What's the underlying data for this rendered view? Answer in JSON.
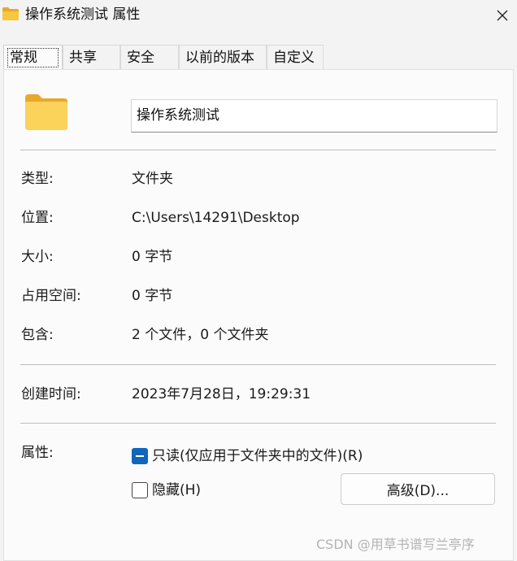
{
  "window": {
    "title": "操作系统测试 属性",
    "icon": "folder-icon",
    "close_icon": "close-icon"
  },
  "tabs": [
    {
      "label": "常规",
      "active": true
    },
    {
      "label": "共享",
      "active": false
    },
    {
      "label": "安全",
      "active": false
    },
    {
      "label": "以前的版本",
      "active": false
    },
    {
      "label": "自定义",
      "active": false
    }
  ],
  "general": {
    "folder_name": "操作系统测试",
    "type_label": "类型:",
    "type_value": "文件夹",
    "location_label": "位置:",
    "location_value": "C:\\Users\\14291\\Desktop",
    "size_label": "大小:",
    "size_value": "0 字节",
    "size_on_disk_label": "占用空间:",
    "size_on_disk_value": "0 字节",
    "contains_label": "包含:",
    "contains_value": "2 个文件，0 个文件夹",
    "created_label": "创建时间:",
    "created_value": "2023年7月28日，19:29:31",
    "attributes_label": "属性:",
    "readonly_label": "只读(仅应用于文件夹中的文件)(R)",
    "readonly_state": "indeterminate",
    "hidden_label": "隐藏(H)",
    "hidden_state": "unchecked",
    "advanced_button": "高级(D)..."
  },
  "watermark": "CSDN @用草书谱写兰亭序",
  "colors": {
    "folder": "#f8c740",
    "checkbox_accent": "#1166bb",
    "panel_bg": "#fbfbfb",
    "window_bg": "#f3f3f3"
  }
}
